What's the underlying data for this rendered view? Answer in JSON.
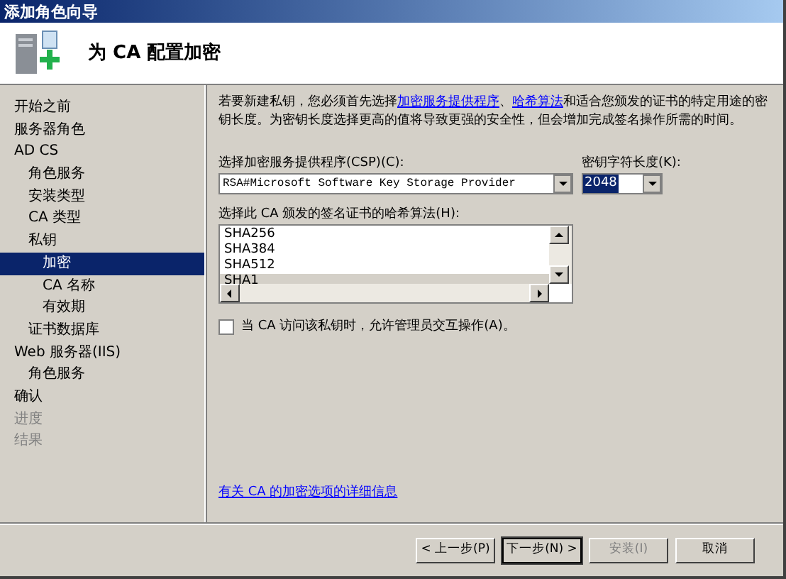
{
  "window": {
    "title": "添加角色向导"
  },
  "header": {
    "title": "为 CA 配置加密"
  },
  "sidebar": {
    "items": [
      {
        "label": "开始之前",
        "selected": false,
        "disabled": false
      },
      {
        "label": "服务器角色",
        "selected": false,
        "disabled": false
      },
      {
        "label": "AD CS",
        "selected": false,
        "disabled": false,
        "children": [
          {
            "label": "角色服务",
            "selected": false,
            "disabled": false
          },
          {
            "label": "安装类型",
            "selected": false,
            "disabled": false
          },
          {
            "label": "CA 类型",
            "selected": false,
            "disabled": false
          },
          {
            "label": "私钥",
            "selected": false,
            "disabled": false,
            "children": [
              {
                "label": "加密",
                "selected": true,
                "disabled": false
              },
              {
                "label": "CA 名称",
                "selected": false,
                "disabled": false
              },
              {
                "label": "有效期",
                "selected": false,
                "disabled": false
              }
            ]
          },
          {
            "label": "证书数据库",
            "selected": false,
            "disabled": false
          }
        ]
      },
      {
        "label": "Web 服务器(IIS)",
        "selected": false,
        "disabled": false,
        "children": [
          {
            "label": "角色服务",
            "selected": false,
            "disabled": false
          }
        ]
      },
      {
        "label": "确认",
        "selected": false,
        "disabled": false
      },
      {
        "label": "进度",
        "selected": false,
        "disabled": true
      },
      {
        "label": "结果",
        "selected": false,
        "disabled": true
      }
    ]
  },
  "description": [
    {
      "kind": "text",
      "text": "若要新建私钥，您必须首先选择"
    },
    {
      "kind": "link",
      "text": "加密服务提供程序"
    },
    {
      "kind": "text",
      "text": "、"
    },
    {
      "kind": "link",
      "text": "哈希算法"
    },
    {
      "kind": "text",
      "text": "和适合您颁发的证书的特定用途的密钥长度。为密钥长度选择更高的值将导致更强的安全性，但会增加完成签名操作所需的时间。"
    }
  ],
  "csp": {
    "label": "选择加密服务提供程序(CSP)(C):",
    "value": "RSA#Microsoft Software Key Storage Provider"
  },
  "key_length": {
    "label": "密钥字符长度(K):",
    "value": "2048"
  },
  "hash": {
    "label": "选择此 CA 颁发的签名证书的哈希算法(H):",
    "items": [
      {
        "label": "SHA256",
        "selected": false
      },
      {
        "label": "SHA384",
        "selected": false
      },
      {
        "label": "SHA512",
        "selected": false
      },
      {
        "label": "SHA1",
        "selected": true
      }
    ]
  },
  "admin_interaction": {
    "label": "当 CA 访问该私钥时，允许管理员交互操作(A)。",
    "checked": false
  },
  "more_info_link": "有关 CA 的加密选项的详细信息",
  "buttons": [
    {
      "label": "< 上一步(P)",
      "disabled": false,
      "default": false
    },
    {
      "label": "下一步(N) >",
      "disabled": false,
      "default": true
    },
    {
      "label": "安装(I)",
      "disabled": true,
      "default": false
    },
    {
      "label": "取消",
      "disabled": false,
      "default": false
    }
  ]
}
